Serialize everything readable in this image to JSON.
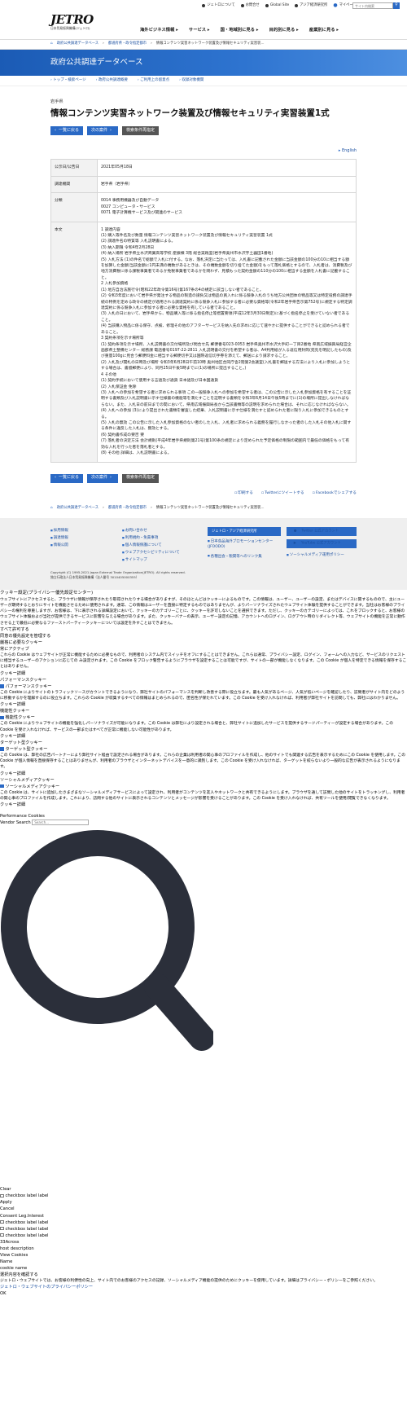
{
  "top_links": [
    "ジェトロについて",
    "お問合せ",
    "Global Site",
    "アジア経済研究所",
    "マイページ"
  ],
  "search": {
    "placeholder": "サイト内検索"
  },
  "logo": {
    "name": "JETRO",
    "sub": "日本貿易振興機構(ジェトロ)"
  },
  "global_nav": [
    "海外ビジネス情報 ▸",
    "サービス ▸",
    "国・地域別に見る ▸",
    "目的別に見る ▸",
    "産業別に見る ▸"
  ],
  "breadcrumb": [
    "トップ",
    "政府公共調達データベース",
    "都道府県・政令指定都市",
    "情報コンテンツ実習ネットワーク装置及び情報セキュリティ実習装..."
  ],
  "banner_title": "政府公共調達データベース",
  "subnav": [
    "トップ・検索ページ",
    "政府公共調達概要",
    "ご利用上の留意点",
    "収録対象機関"
  ],
  "prefecture": "岩手県",
  "page_title": "情報コンテンツ実習ネットワーク装置及び情報セキュリティ実習装置1式",
  "buttons": {
    "list": "一覧に戻る",
    "next": "次の案件",
    "research": "検索条件再指定"
  },
  "lang_link": "English",
  "table": [
    {
      "k": "公示日/公告日",
      "v": "2021年05月18日"
    },
    {
      "k": "調達機関",
      "v": "岩手県（岩手県）"
    },
    {
      "k": "分類",
      "v": "0014 事務用機器及び自動データ\n0027 コンピュータ・サービス\n0071 電子計算機サービス及び関連のサービス"
    },
    {
      "k": "本文",
      "v": "1 調達内容\n(1) 購入等件名及び数量 情報コンテンツ実習ネットワーク装置及び情報セキュリティ実習装置 1式\n(2) 調達件名の特質等 入札説明書による。\n(3) 納入期限 令和4年2月28日\n(4) 納入場所 岩手県立水沢商業高等学校 産振棟 3階 総合実践室(岩手県奥州市水沢字土器田1番地)\n(5) 入札方法 (1)の件名で総額で入札に付する。なお、落札決定に当たっては、入札書に記載された金額に当該金額の100分の10に相当する額を加算した金額(当該金額に1円未満の端数があるときは、その端数金額を切り捨てた金額)をもって落札価格とするので、入札者は、消費税及び地方消費税に係る課税事業者であるか免税事業者であるかを問わず、見積もった契約金額の110分の100に相当する金額を入札書に記載すること。\n2 入札参加資格\n(1) 地方自治法施行令(昭和22年政令第16号)第167条の4の規定に該当しない者であること。\n(2) 令和3年度において岩手県が発注する物品の製造の請負又は物品の買入れに係る競争入札のうち地方公共団体の物品等又は特定役務の調達手続の特例を定める政令の規定が適用される調達契約に係る競争入札に参加する者に必要な資格等(令和2年岩手県告示第752号)に規定する特定調達契約に係る競争入札に参加する者に必要な資格を有している者であること。\n(3) 入札の日において、岩手県から、物品購入等に係る指名停止等措置要領(平成12年3月30日制定)に基づく指名停止を受けていない者であること。\n(4) 当該購入物品に係る保守、点検、修理その他のアフターサービスを納入先の求めに応じて速やかに提供することができると認められる者であること。\n3 契約条項を示す場所等\n(1) 契約条項を示す場所、入札説明書の交付場所及び問合せ先 郵便番号023-0053 岩手県奥州市水沢大手町一丁目2番地 県南広域振興局経営企画部県土整備センター 総務課 電話番号0197-22-2811 入札説明書の交付を希望する者は、A4判用紙が入る返信用封筒(宛先を明記したもの)及び重量100gに見合う郵便料金に相当する郵便切手又は国際返信切手券を添えて、郵送により請求すること。\n(2) 入札及び開札の日時及び場所 令和3年6月28日午前10時 奥州地区合同庁舎2階第2会議室(入札書を郵送する方法により入札に参加しようとする場合は、書留郵便により、同月25日午後5時までに(1)の場所に提出すること。)\n4 その他\n(1) 契約手続において使用する言語及び通貨 日本語及び日本国通貨\n(2) 入札保証金 免除\n(3) 入札への参加を希望する者に求められる事項 この一般競争入札への参加を希望する者は、この公告に示した入札参加資格を有することを証明する書類及び入札説明書に示す仕様書の機能等を満たすことを証明する書類を令和3年6月14日午後5時までに(1)の場所に提出しなければならない。また、入札日の前日までの間において、県南広域振興局長から当該書類等の説明を求められた場合は、それに応じなければならない。\n(4) 入札への参加 (3)により提出された書類を審査した結果、入札説明書に示す仕様を満たすと認められた者に限り入札に参加できるものとする。\n(5) 入札の無効 この公告に示した入札参加資格のない者のした入札、入札者に求められる義務を履行しなかった者のした入札その他入札に関する条件に違反した入札は、無効とする。\n(6) 契約書作成の要否 要\n(7) 落札者の決定方法 会計規則(平成4年岩手県規則第21号)第100条の規定により定められた予定価格の制限の範囲内で最低の価格をもって有効な入札を行った者を落札者とする。\n(8) その他 詳細は、入札説明書による。"
    }
  ],
  "social": [
    "印刷する",
    "Twitterにツイートする",
    "Facebookでシェアする"
  ],
  "footer": {
    "col1": [
      "採用情報",
      "調達情報",
      "情報公開"
    ],
    "col2": [
      "お問い合わせ",
      "利用規約・免責事項",
      "個人情報保護について",
      "ウェブアクセシビリティについて",
      "サイトマップ"
    ],
    "col3_btn": "ジェトロ・アジア経済研究所",
    "col3_links": [
      "日本食品海外プロモーションセンター(JFOODO)",
      "各種出会・税関等へのリンク集"
    ],
    "col4_btns": [
      "Twitter 公式アカウント",
      "YouTube 公式アカウント"
    ],
    "col4_link": "ソーシャルメディア運用ポリシー",
    "copyright": "Copyright (C) 1995-2021 Japan External Trade Organization(JETRO). All rights reserved.",
    "org": "独立行政法人日本貿易振興機構（法人番号 3010405000355）"
  },
  "cookie": {
    "heading": "クッキー設定(プライバシー優先設定センター)",
    "intro": "ウェブサイトにアクセスすると、ブラウザに情報が保存されたり取得されたりする場合がありますが、そのほとんどはクッキーによるものです。この情報は、ユーザー、ユーザーの設定、またはデバイスに関するものので、主にユーザーが期待するとおりにサイトを機能させるために使用されます。通常、この情報はユーザーを直接に特定するものではありませんが、よりパーソナライズされたウェブサイト体験を提供することができます。当社はお客様のプライバシーの権利を尊重しますが、お客様は、下に表示される詳細設定において、クッキーのカテゴリーごとに、クッキーを許可しないことを選択できます。ただし、クッキーのカテゴリーによっては、これをブロックすると、お客様のウェブサイト体験および当社が提供できるサービスに影響を与える場合があります。また、クッキーバナーの表示、ユーザー設定の記憶、アカウントへのログイン、ログアウト時のリダイレクト等、ウェブサイトの機能を正常に動作させる上で最低に必要なるファーストパーティークッキーについては設定を外すことはできません。",
    "allow_all": "すべて許可する",
    "manage": "同意の優先設定を管理する",
    "c1_title": "厳格に必要なクッキー",
    "c1_status": "常にアクティブ",
    "c1_desc": "これらの Cookie はウェブサイトが正常に機能するために必要なもので、利用者のシステム内でスイッチをオフにすることはできません。これらは通常、プライバシー設定、ログイン、フォームへの入力など、サービスのリクエストに相当するユーザーのアクションに応じての み設定されます。この Cookie をブロック警告するようにブラウザを設定することは可能ですが、サイトの一部が機能しなくなります。この Cookie が個人を特定できる情報を保存することはありません。",
    "details": "クッキー詳細",
    "c2_title": "パフォーマンスクッキー",
    "c2_label": "パフォーマンスクッキー",
    "c2_desc": "この Cookie によりサイトのトラフィックソースがカウントできるようになり、弊社サイトのパフォーマンスを判断し改善する際に役立ちます。最も人気があるページ、人気が低いページを確認したり、訪問者がサイト内をどのように移動するかを理解するのに役立ちます。これらの Cookie が収集するすべての情報はまとめられるので、匿名性が保たれています。この Cookie を受け入れなければ、利用者が弊社サイトを訪問しても、弊社にはわかりません。",
    "c3_title": "機能性クッキー",
    "c3_label": "機能性クッキー",
    "c3_desc": "この Cookie によりウェブサイトの機能を強化しパーソナライズが可能になります。この Cookie は弊社により設定される場合と、弊社サイトに追加したサービスを提供するサードパーティーが設定する場合があります。この Cookie を受け入れなければ、サービスの一部またはすべてが正常に機能しない可能性があります。",
    "c4_title": "ターゲット型クッキー",
    "c4_label": "ターゲット型クッキー",
    "c4_desc": "この Cookie は、弊社の広告パートナーにより弊社サイト経由で設定される場合があります。これらの企業は利用者の関心事のプロファイルを作成し、他のサイトでも関連する広告を表示するためにこの Cookie を使用します。この Cookie が個人情報を直接保存することはありませんが、利用者のブラウザとインターネットデバイスを一意的に識別します。この Cookie を受け入れなければ、ターゲットを絞らないより一般的な広告が表示されるようになります。",
    "c5_title": "ソーシャルメディアクッキー",
    "c5_label": "ソーシャルメディアクッキー",
    "c5_desc": "この Cookie は、サイトに追加したさまざまなソーシャルメディアサービスによって設定され、利用者がコンテンツを友人やネットワークと共有できるようにします。ブラウザを通して訪問した他のサイトをトラッキングし、利用者の関心事のプロファイルを作成します。これにより、訪問する他のサイトに表示されるコンテンツとメッセージが影響を受けることがあります。この Cookie を受け入れなければ、共有ツールを使用/閲覧できなくなります。",
    "perf_heading": "Performance Cookies",
    "vendor_search_label": "Vendor Search",
    "vendor_search_placeholder": "Search...",
    "clear": "Clear",
    "checkbox_label": "checkbox label label",
    "apply": "Apply",
    "cancel": "Cancel",
    "consent_legit": "Consent Leg.Interest",
    "across": "33Across",
    "host_desc": "host description",
    "view_cookies": "View Cookies",
    "name": "Name",
    "cookie_name": "cookie name",
    "confirm": "選択内容を確認する",
    "notice": "ジェトロ・ウェブサイトでは、お客様の利便性の向上、サイト内でのお客様のアクセスの記録、ソーシャルメディア機能の提供のためにクッキーを使用しています。詳細はプライバシー・ポリシーをご参照ください。",
    "privacy_link": "ジェトロ・ウェブサイトのプライバシーポリシー",
    "ok": "OK"
  }
}
